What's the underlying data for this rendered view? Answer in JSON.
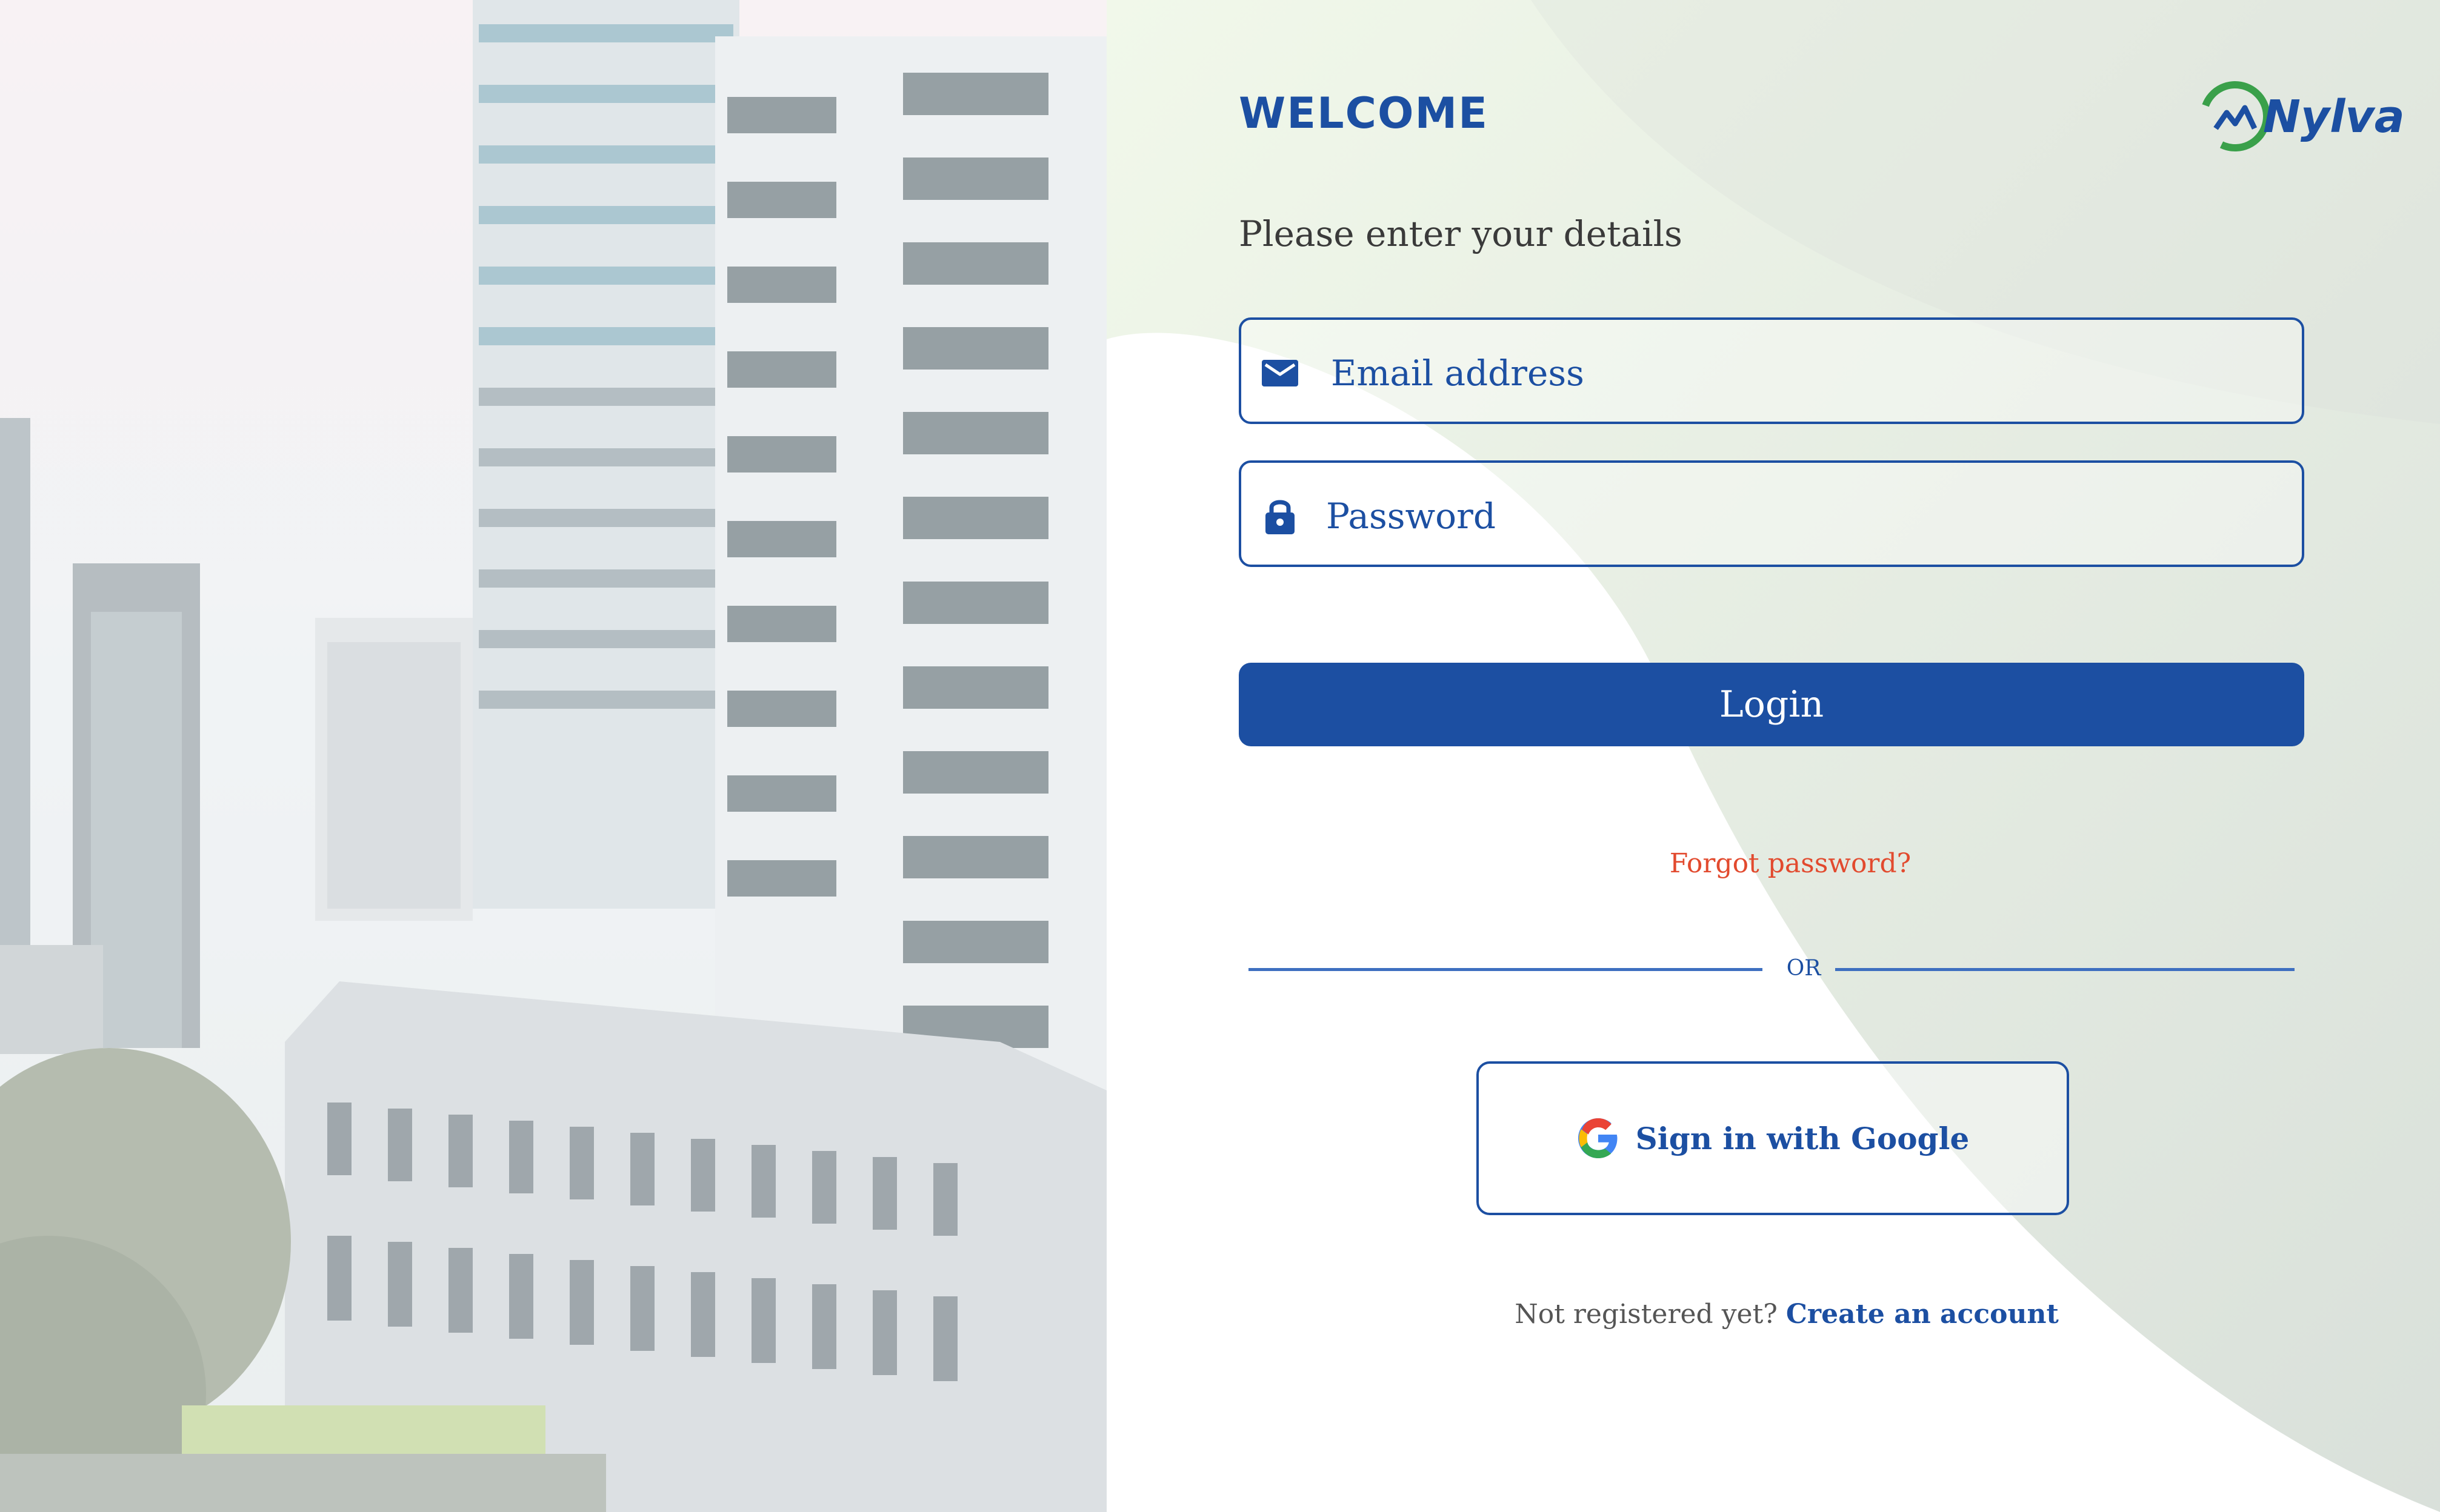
{
  "header": {
    "welcome": "WELCOME",
    "logo_text": "Nylva"
  },
  "form": {
    "subtitle": "Please enter your details",
    "email_placeholder": "Email address",
    "password_placeholder": "Password",
    "login_label": "Login",
    "forgot_label": "Forgot password?",
    "divider_label": "OR",
    "google_label": "Sign in with Google",
    "register_prompt": "Not registered yet?",
    "register_link": "Create an account"
  },
  "icons": {
    "email": "envelope-icon",
    "password": "lock-icon",
    "google": "google-icon",
    "logo": "nylva-logo"
  },
  "colors": {
    "primary": "#1c4fa2",
    "forgot": "#e24a2e",
    "accent_green": "#3aa04a",
    "wash_green": "#eef6e6"
  }
}
